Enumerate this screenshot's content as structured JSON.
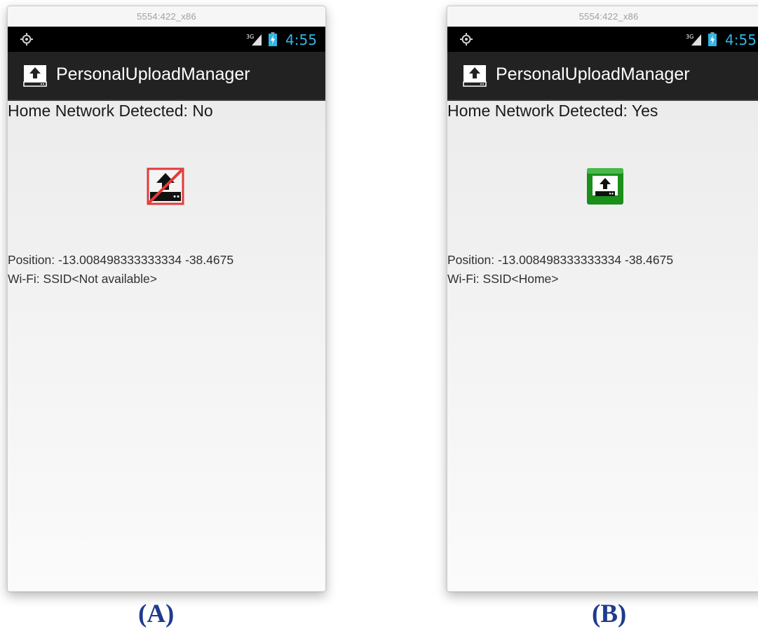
{
  "panels": [
    {
      "window_title": "5554:422_x86",
      "status_bar": {
        "time": "4:55",
        "network": "3G"
      },
      "app_title": "PersonalUploadManager",
      "home_network": "Home Network Detected: No",
      "upload_state": "upload-disabled",
      "status_color": "#e33a3a",
      "position": "Position: -13.008498333333334 -38.4675",
      "wifi": "Wi-Fi: SSID<Not available>",
      "label": "(A)"
    },
    {
      "window_title": "5554:422_x86",
      "status_bar": {
        "time": "4:55",
        "network": "3G"
      },
      "app_title": "PersonalUploadManager",
      "home_network": "Home Network Detected: Yes",
      "upload_state": "upload-enabled",
      "status_color": "#1a8f1a",
      "position": "Position: -13.008498333333334 -38.4675",
      "wifi": "Wi-Fi: SSID<Home>",
      "label": "(B)"
    }
  ],
  "colors": {
    "action_bar": "#222222",
    "status_bar": "#000000",
    "clock": "#33b5e5",
    "label": "#1f3a8f"
  }
}
